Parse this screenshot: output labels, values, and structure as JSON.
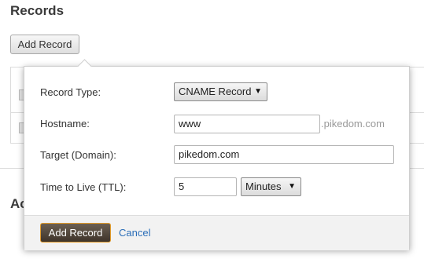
{
  "page": {
    "title": "Records",
    "add_record_label": "Add Record",
    "lower_heading": "Ac"
  },
  "dialog": {
    "record_type": {
      "label": "Record Type:",
      "selected": "CNAME Record"
    },
    "hostname": {
      "label": "Hostname:",
      "value": "www",
      "suffix": ".pikedom.com"
    },
    "target": {
      "label": "Target (Domain):",
      "value": "pikedom.com"
    },
    "ttl": {
      "label": "Time to Live (TTL):",
      "value": "5",
      "unit": "Minutes"
    },
    "submit_label": "Add Record",
    "cancel_label": "Cancel"
  },
  "icons": {
    "dropdown": "triangle-down"
  }
}
